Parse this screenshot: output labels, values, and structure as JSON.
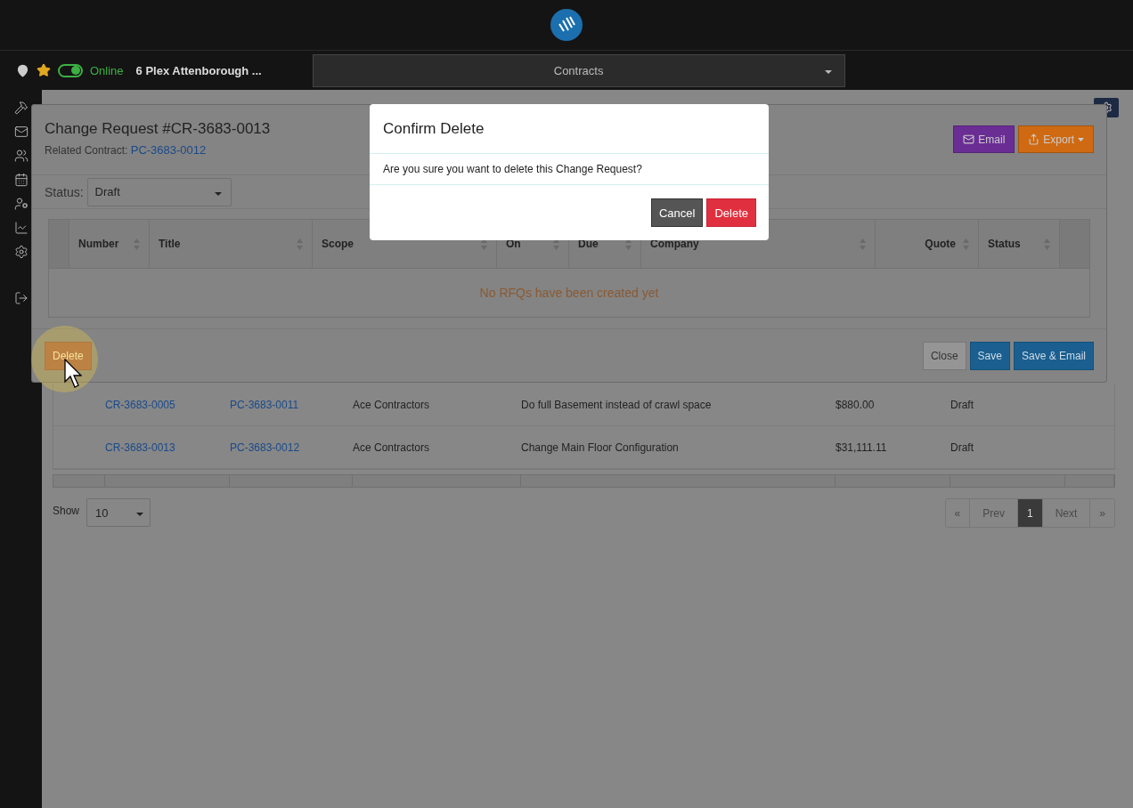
{
  "app_bar": {
    "location": "6 Plex Attenborough ...",
    "online": {
      "on": true,
      "label": "Online"
    },
    "module_select": "Contracts"
  },
  "change_request_modal": {
    "title": "Change Request #CR-3683-0013",
    "related_label": "Related Contract:",
    "related_link": "PC-3683-0012",
    "actions": [
      {
        "label": "Email",
        "kind": "email"
      },
      {
        "label": "Export",
        "kind": "export"
      }
    ],
    "status_label": "Status:",
    "status_value": "Draft",
    "rfq_table": {
      "columns": [
        {
          "sortable": false
        },
        {
          "label": "Number",
          "sortable": true
        },
        {
          "label": "Title",
          "sortable": true
        },
        {
          "label": "Scope",
          "sortable": true
        },
        {
          "label": "On",
          "sortable": true
        },
        {
          "label": "Due",
          "sortable": true
        },
        {
          "label": "Company",
          "sortable": true
        },
        {
          "label": "Quote",
          "sortable": true
        },
        {
          "label": "Status",
          "sortable": true
        },
        {
          "sortable": false
        }
      ],
      "empty_message": "No RFQs have been created yet"
    },
    "footer_buttons": [
      {
        "label": "Delete",
        "kind": "danger"
      },
      {
        "label": "Close",
        "kind": "default"
      },
      {
        "label": "Save",
        "kind": "primary"
      },
      {
        "label": "Save & Email",
        "kind": "primary"
      }
    ]
  },
  "confirm_dialog": {
    "title": "Confirm Delete",
    "message": "Are you sure you want to delete this Change Request?",
    "buttons": [
      {
        "label": "Cancel",
        "kind": "secondary"
      },
      {
        "label": "Delete",
        "kind": "danger"
      }
    ]
  },
  "contracts_table": {
    "rows": [
      {
        "number": "CR-3683-0005",
        "contract": "PC-3683-0011",
        "company": "Ace Contractors",
        "title": "Do full Basement instead of crawl space",
        "quote": "$880.00",
        "status": "Draft"
      },
      {
        "number": "CR-3683-0013",
        "contract": "PC-3683-0012",
        "company": "Ace Contractors",
        "title": "Change Main Floor Configuration",
        "quote": "$31,111.11",
        "status": "Draft"
      }
    ]
  },
  "page_size": {
    "label": "Show",
    "value": "10"
  },
  "pagination": {
    "items": [
      {
        "label": "«",
        "selected": false,
        "disabled": true
      },
      {
        "label": "Prev",
        "selected": false,
        "disabled": true
      },
      {
        "label": "1",
        "selected": true,
        "disabled": false
      },
      {
        "label": "Next",
        "selected": false,
        "disabled": true
      },
      {
        "label": "»",
        "selected": false,
        "disabled": true
      }
    ]
  }
}
